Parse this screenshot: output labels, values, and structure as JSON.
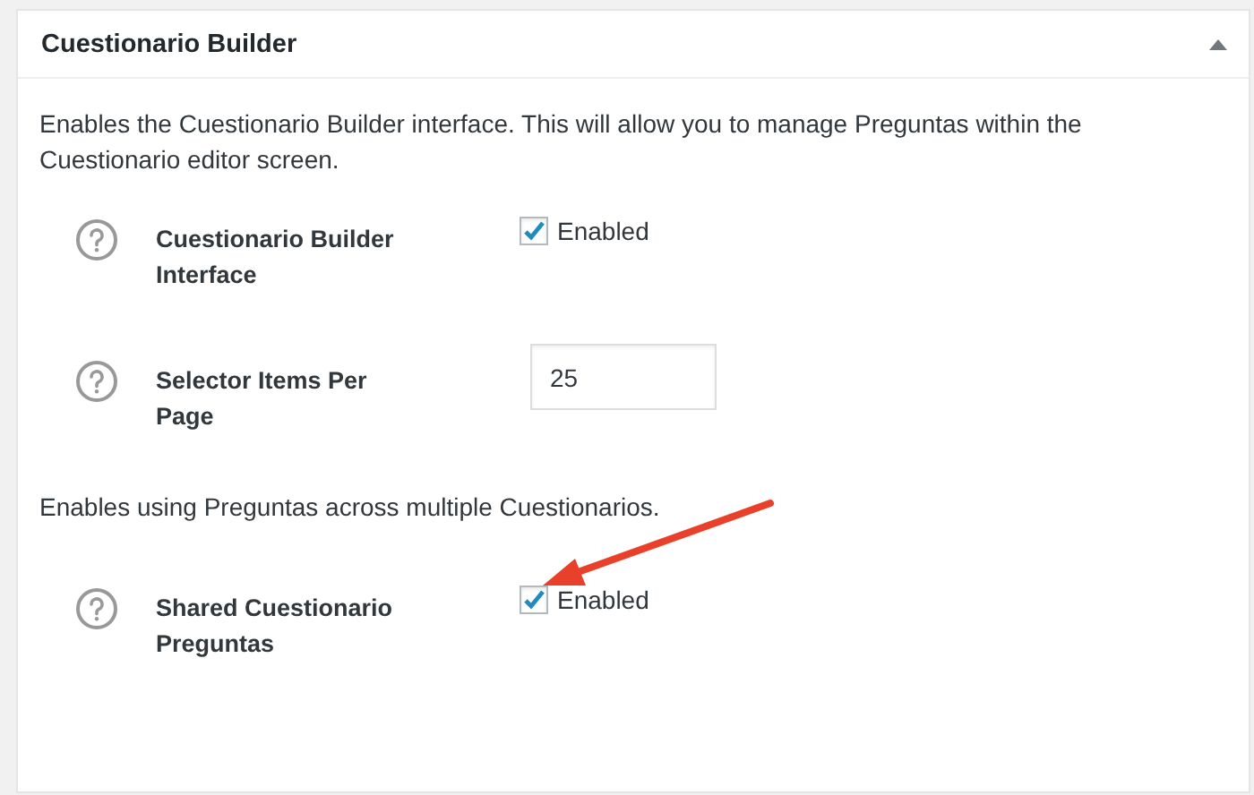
{
  "panel": {
    "title": "Cuestionario Builder",
    "expanded": true
  },
  "sections": [
    {
      "description": "Enables the Cuestionario Builder interface. This will allow you to manage Preguntas within the Cuestionario editor screen.",
      "settings": [
        {
          "label": "Cuestionario Builder Interface",
          "kind": "checkbox",
          "checked": true,
          "option": "Enabled"
        },
        {
          "label": "Selector Items Per Page",
          "kind": "number",
          "value": "25"
        }
      ]
    },
    {
      "description": "Enables using Preguntas across multiple Cuestionarios.",
      "settings": [
        {
          "label": "Shared Cuestionario Preguntas",
          "kind": "checkbox",
          "checked": true,
          "option": "Enabled"
        }
      ]
    }
  ]
}
